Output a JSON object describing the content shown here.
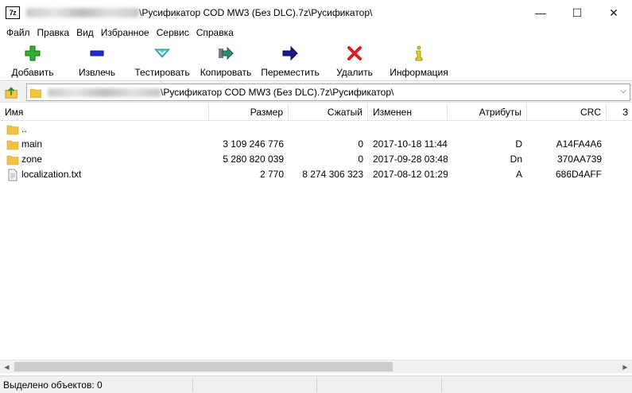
{
  "app": {
    "icon_text": "7z",
    "title_path": "\\Русификатор COD MW3 (Без DLC).7z\\Русификатор\\",
    "window_controls": [
      "—",
      "☐",
      "✕"
    ]
  },
  "menu": [
    "Файл",
    "Правка",
    "Вид",
    "Избранное",
    "Сервис",
    "Справка"
  ],
  "toolbar": {
    "add": "Добавить",
    "extract": "Извлечь",
    "test": "Тестировать",
    "copy": "Копировать",
    "move": "Переместить",
    "delete": "Удалить",
    "info": "Информация"
  },
  "address": {
    "path": "\\Русификатор COD MW3 (Без DLC).7z\\Русификатор\\",
    "chevron": "⌵"
  },
  "columns": {
    "name": "Имя",
    "size": "Размер",
    "packed": "Сжатый",
    "modified": "Изменен",
    "attributes": "Атрибуты",
    "crc": "CRC",
    "extra": "З"
  },
  "files": [
    {
      "name": "..",
      "type": "folder",
      "size": "",
      "packed": "",
      "modified": "",
      "attributes": "",
      "crc": ""
    },
    {
      "name": "main",
      "type": "folder",
      "size": "3 109 246 776",
      "packed": "0",
      "modified": "2017-10-18 11:44",
      "attributes": "D",
      "crc": "A14FA4A6"
    },
    {
      "name": "zone",
      "type": "folder",
      "size": "5 280 820 039",
      "packed": "0",
      "modified": "2017-09-28 03:48",
      "attributes": "Dn",
      "crc": "370AA739"
    },
    {
      "name": "localization.txt",
      "type": "file",
      "size": "2 770",
      "packed": "8 274 306 323",
      "modified": "2017-08-12 01:29",
      "attributes": "A",
      "crc": "686D4AFF"
    }
  ],
  "status": {
    "selected": "Выделено объектов: 0"
  },
  "colors": {
    "folder": "#f3c343",
    "add": "#2fb12f",
    "extract": "#1f2bd0",
    "test": "#5bc6d6",
    "copy": "#2c8c7a",
    "move": "#1a1a8c",
    "delete": "#d42020",
    "info": "#e5d41f"
  }
}
